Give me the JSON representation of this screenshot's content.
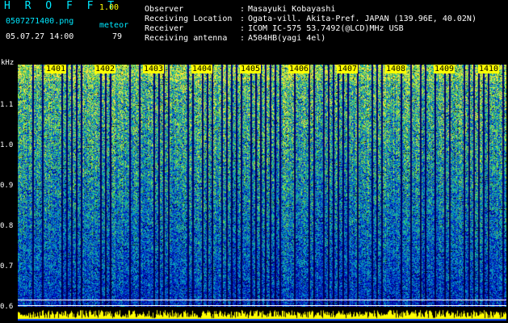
{
  "header": {
    "app_title": "H R O F F T",
    "version": "1.00",
    "filename": "0507271400.png",
    "timestamp": "05.07.27 14:00",
    "meteor_label": "meteor",
    "meteor_count": "79"
  },
  "info": [
    {
      "label": "Observer",
      "sep": ":",
      "value": "Masayuki Kobayashi"
    },
    {
      "label": "Receiving Location",
      "sep": ":",
      "value": "Ogata-vill. Akita-Pref. JAPAN (139.96E, 40.02N)"
    },
    {
      "label": "Receiver",
      "sep": ":",
      "value": "ICOM IC-575 53.7492(@LCD)MHz USB"
    },
    {
      "label": "Receiving antenna",
      "sep": ":",
      "value": "A504HB(yagi 4el)"
    }
  ],
  "axis": {
    "unit": "kHz",
    "ticks": [
      "1.1",
      "1.0",
      "0.9",
      "0.8",
      "0.7",
      "0.6"
    ]
  },
  "time_ticks": [
    "1401",
    "1402",
    "1403",
    "1404",
    "1405",
    "1406",
    "1407",
    "1408",
    "1409",
    "1410"
  ],
  "colors": {
    "accent": "#00e8ff",
    "highlight": "#ffff00",
    "background": "#000000"
  }
}
